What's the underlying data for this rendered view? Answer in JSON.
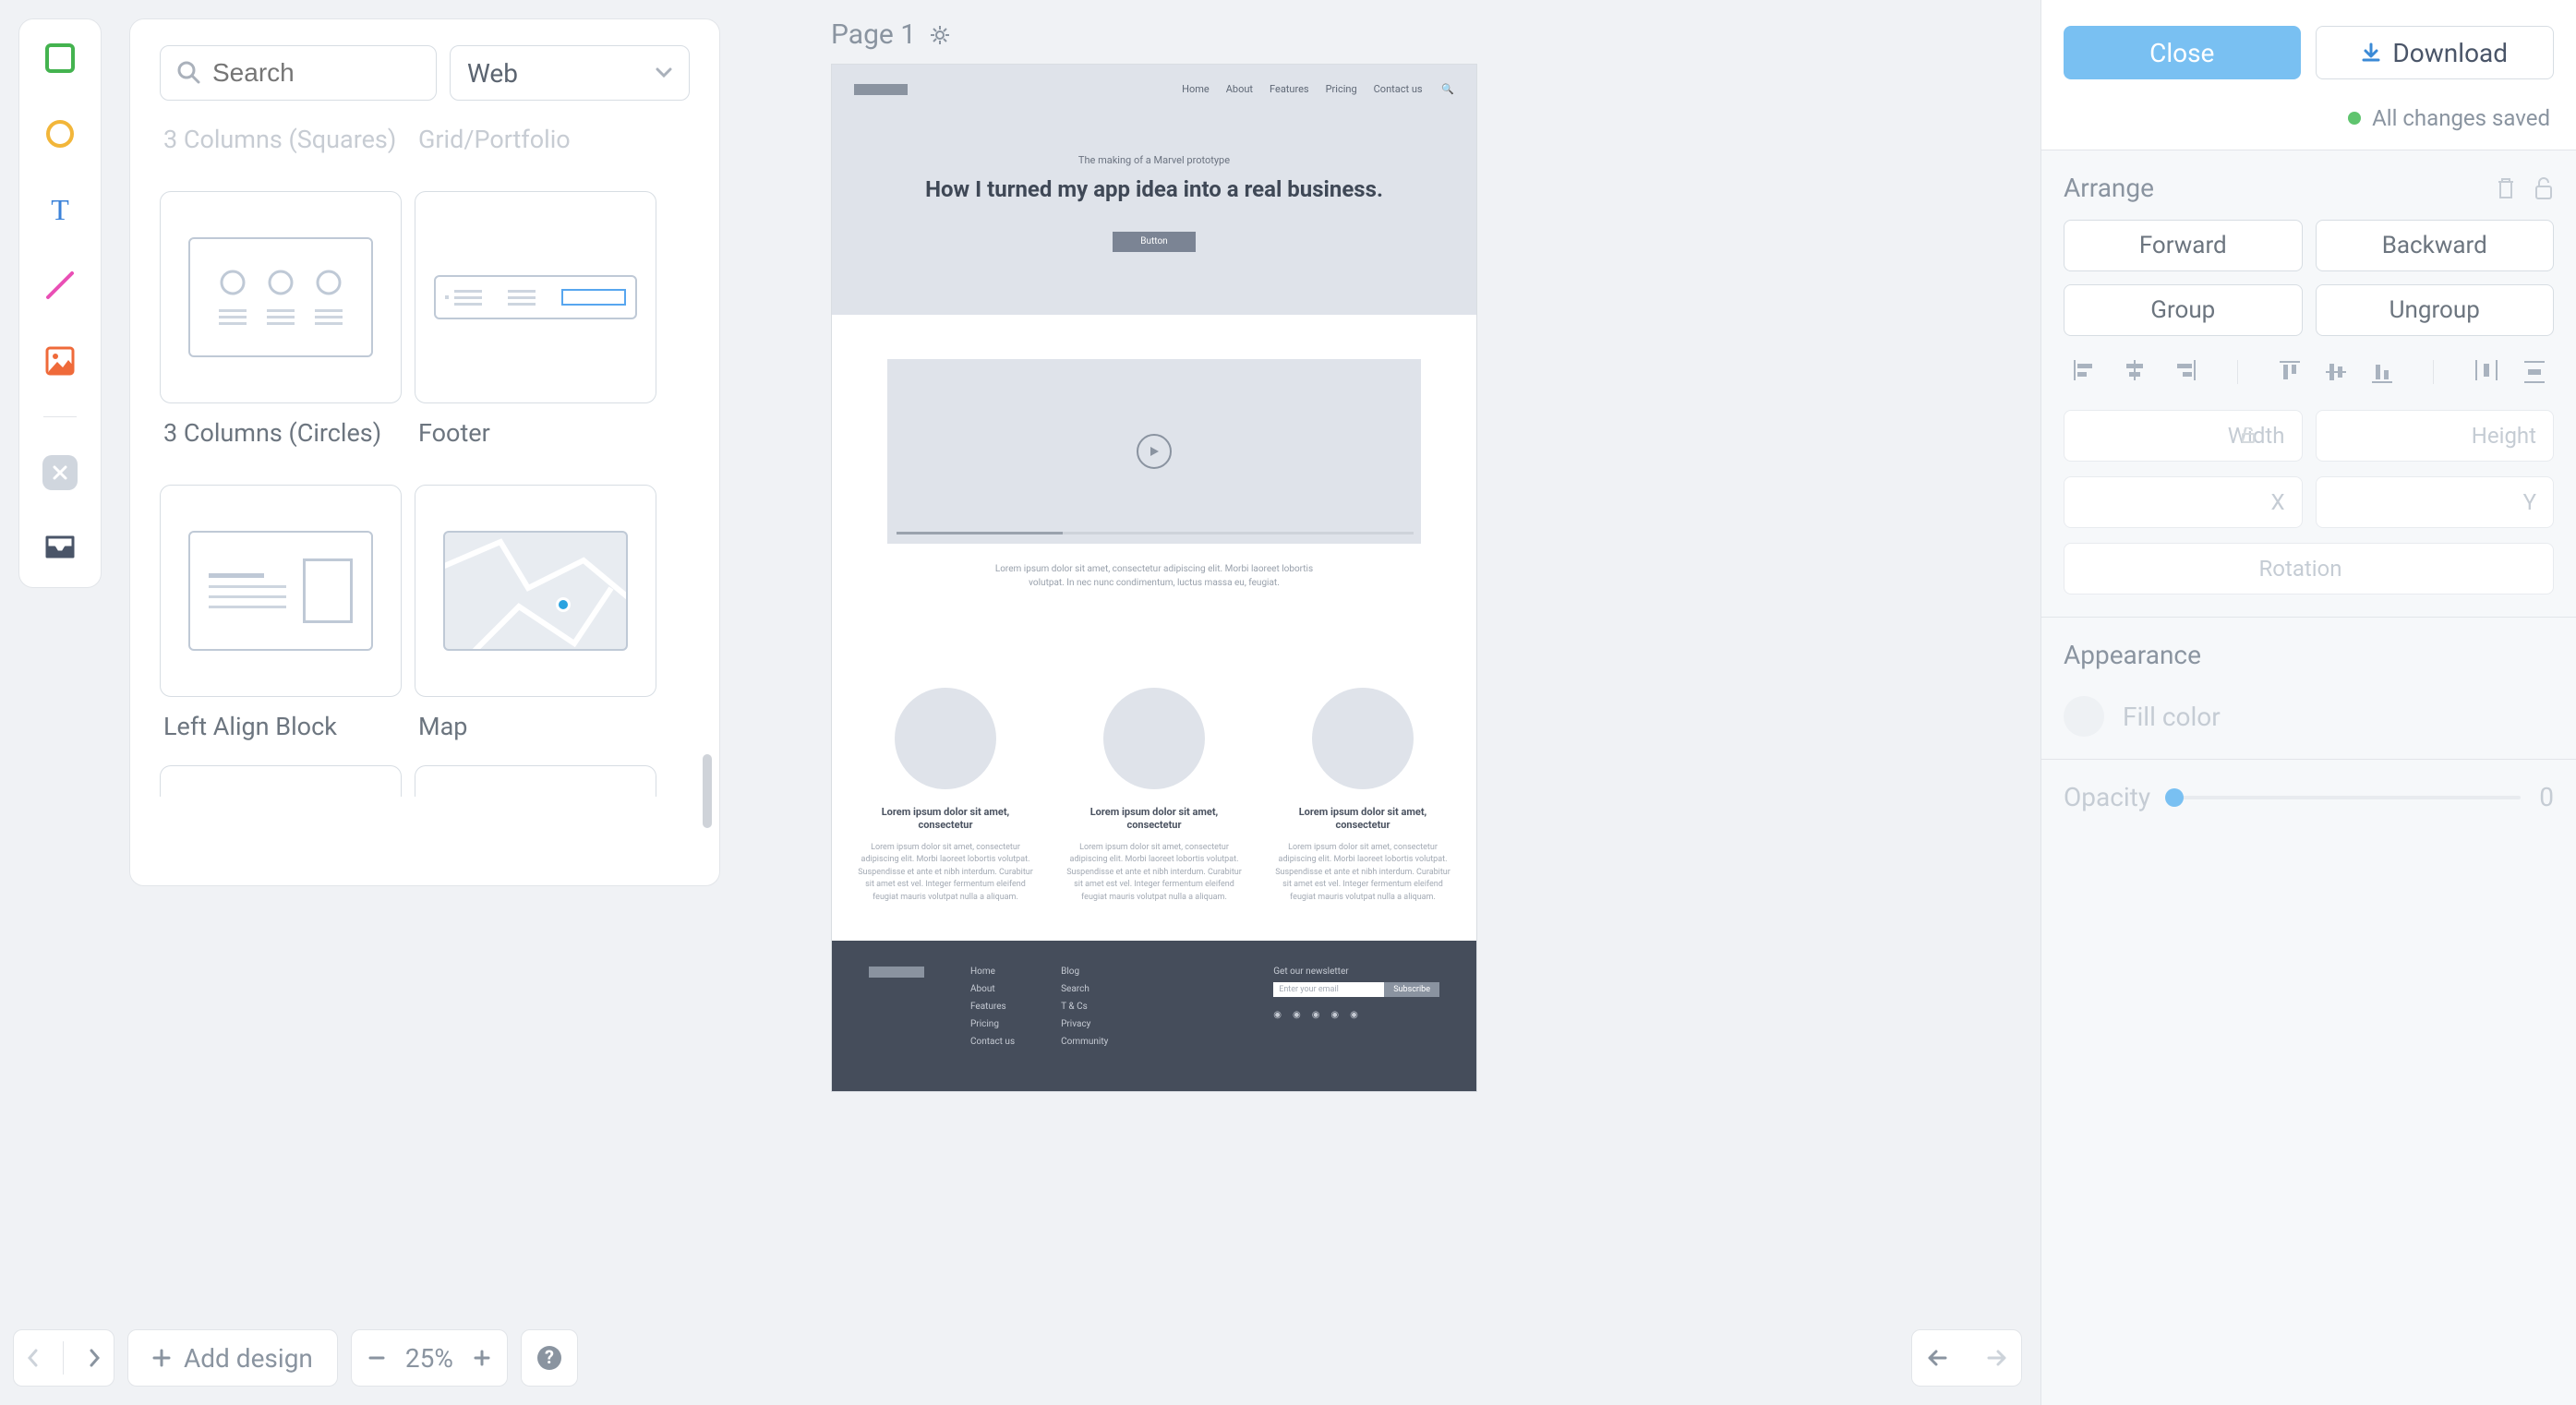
{
  "toolbar": {
    "tools": [
      "rectangle",
      "circle",
      "text",
      "line",
      "image"
    ]
  },
  "components": {
    "search_placeholder": "Search",
    "category": "Web",
    "tiles_truncated": [
      {
        "label": "3 Columns (Squares)"
      },
      {
        "label": "Grid/Portfolio"
      }
    ],
    "tiles": [
      {
        "label": "3 Columns (Circles)"
      },
      {
        "label": "Footer"
      },
      {
        "label": "Left Align Block"
      },
      {
        "label": "Map"
      }
    ]
  },
  "canvas": {
    "page_label": "Page 1",
    "mock": {
      "nav": [
        "Home",
        "About",
        "Features",
        "Pricing",
        "Contact us"
      ],
      "subtitle": "The making of a Marvel prototype",
      "title": "How I turned my app idea into a real business.",
      "button": "Button",
      "lorem_short": "Lorem ipsum dolor sit amet, consectetur adipiscing elit. Morbi laoreet lobortis volutpat. In nec nunc condimentum, luctus massa eu, feugiat.",
      "col_heading": "Lorem ipsum dolor sit amet, consectetur",
      "col_body": "Lorem ipsum dolor sit amet, consectetur adipiscing elit. Morbi laoreet lobortis volutpat. Suspendisse et ante et nibh interdum. Curabitur sit amet est vel. Integer fermentum eleifend feugiat mauris volutpat nulla a aliquam.",
      "footer_cols": [
        [
          "Home",
          "About",
          "Features",
          "Pricing",
          "Contact us"
        ],
        [
          "Blog",
          "Search",
          "T & Cs",
          "Privacy",
          "Community"
        ]
      ],
      "newsletter_label": "Get our newsletter",
      "newsletter_placeholder": "Enter your email",
      "newsletter_button": "Subscribe"
    }
  },
  "right": {
    "close": "Close",
    "download": "Download",
    "saved": "All changes saved",
    "arrange": {
      "title": "Arrange",
      "forward": "Forward",
      "backward": "Backward",
      "group": "Group",
      "ungroup": "Ungroup",
      "width": "Width",
      "height": "Height",
      "x": "X",
      "y": "Y",
      "rotation": "Rotation"
    },
    "appearance": {
      "title": "Appearance",
      "fill": "Fill color",
      "opacity": "Opacity",
      "opacity_value": "0"
    }
  },
  "bottom": {
    "add_design": "Add design",
    "zoom": "25%"
  }
}
